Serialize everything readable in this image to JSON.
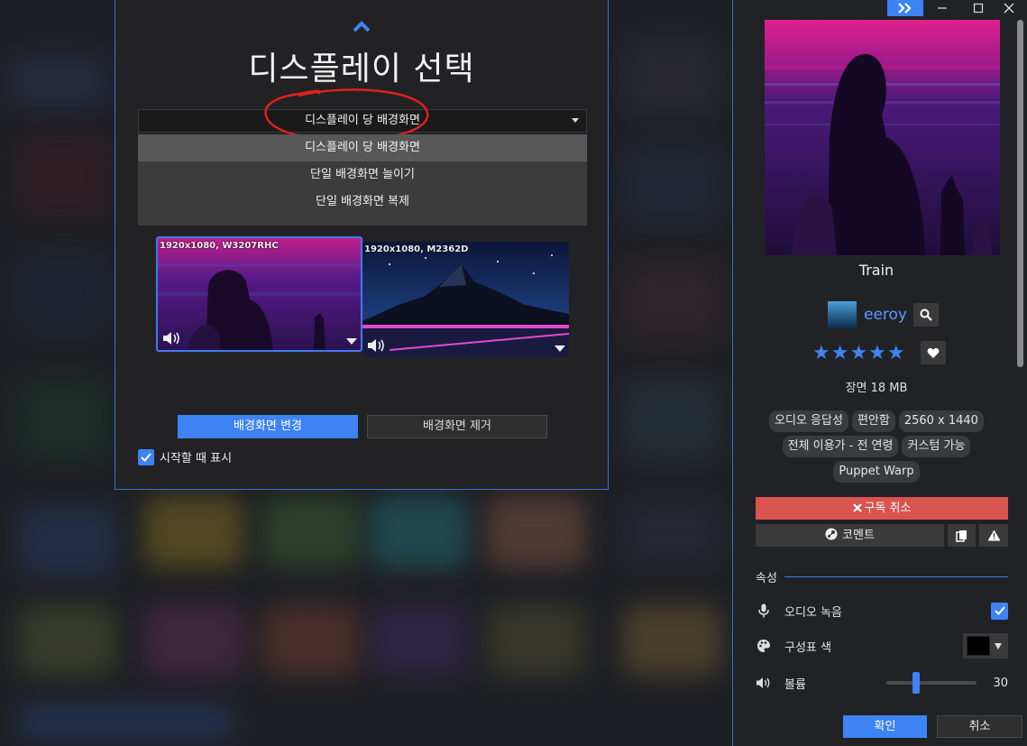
{
  "dialog": {
    "title": "디스플레이 선택",
    "select_value": "디스플레이 당 배경화면",
    "dropdown_options": [
      "디스플레이 당 배경화면",
      "단일 배경화면 늘이기",
      "단일 배경화면 복제"
    ],
    "monitors": [
      {
        "label": "1920x1080, W3207RHC"
      },
      {
        "label": "1920x1080, M2362D"
      }
    ],
    "change_button": "배경화면 변경",
    "remove_button": "배경화면 제거",
    "show_on_start": "시작할 때 표시",
    "show_on_start_checked": true
  },
  "panel": {
    "wallpaper_title": "Train",
    "author": "eeroy",
    "rating_stars": "★★★★★",
    "meta": "장면 18 MB",
    "tags": [
      "오디오 응답성",
      "편안함",
      "2560 x 1440",
      "전체 이용가 - 전 연령",
      "커스텀 가능",
      "Puppet Warp"
    ],
    "unsubscribe_button": "구독 취소",
    "comment_button": "코멘트",
    "properties_heading": "속성",
    "properties": {
      "audio_record_label": "오디오 녹음",
      "audio_record_checked": true,
      "scheme_color_label": "구성표 색",
      "scheme_color": "#000000",
      "volume_label": "볼륨",
      "volume_value": "30"
    },
    "ok_button": "확인",
    "cancel_button": "취소"
  },
  "colors": {
    "accent": "#3d83f4",
    "danger": "#d9534f",
    "dialog_bg": "#222224"
  }
}
